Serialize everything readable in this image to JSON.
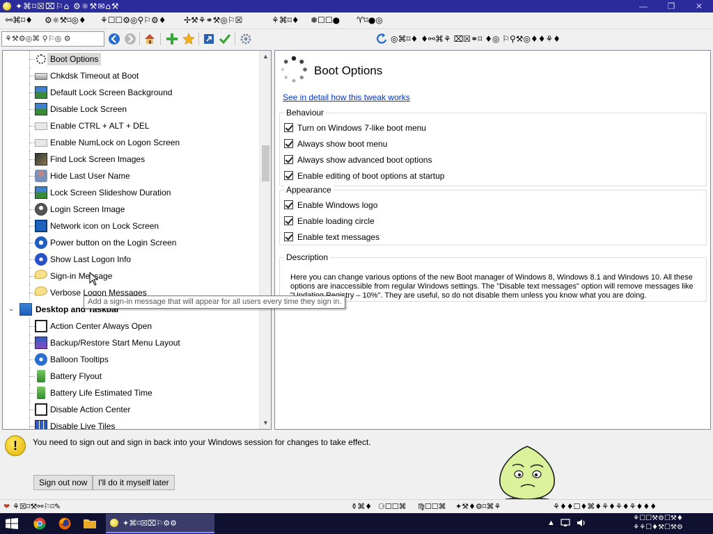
{
  "window": {
    "title": "✦⌘⌑☒⌧⚐⌂ ⚙⚛⚒✉⌂⚒",
    "minimize": "—",
    "maximize": "❐",
    "close": "✕"
  },
  "menu": [
    "⚯⌘⌑♦",
    "⚙⚛⚒⌑◎♦",
    "⚘☐☐⚙◎⚲⚐⚙♦",
    "✢⚒⚘⚭⚒◎⚐☒",
    "⚘⌘⌑♦",
    "❅☐☐●",
    "♈⌑●◎"
  ],
  "toolbar": {
    "search_placeholder": "⚘⚒⚙◎⌘ ⚲⚐◎ ⚙",
    "action_label": "◎⌘⌑♦ ♦⚯⌘⚘ ⌧☒⚭⌑ ♦◎ ⚐⚲⚒◎♦♦⚘♦"
  },
  "tree": {
    "items_top": [
      {
        "label": "Boot Options",
        "icon": "spinner-icon",
        "selected": true
      },
      {
        "label": "Chkdsk Timeout at Boot",
        "icon": "drive-icon"
      },
      {
        "label": "Default Lock Screen Background",
        "icon": "landscape-icon"
      },
      {
        "label": "Disable Lock Screen",
        "icon": "landscape-icon"
      },
      {
        "label": "Enable CTRL + ALT + DEL",
        "icon": "keyboard-icon"
      },
      {
        "label": "Enable NumLock on Logon Screen",
        "icon": "keyboard-icon"
      },
      {
        "label": "Find Lock Screen Images",
        "icon": "image-search-icon"
      },
      {
        "label": "Hide Last User Name",
        "icon": "user-icon"
      },
      {
        "label": "Lock Screen Slideshow Duration",
        "icon": "landscape-icon"
      },
      {
        "label": "Login Screen Image",
        "icon": "user-circle-icon"
      },
      {
        "label": "Network icon on Lock Screen",
        "icon": "monitor-icon"
      },
      {
        "label": "Power button on the Login Screen",
        "icon": "power-icon"
      },
      {
        "label": "Show Last Logon Info",
        "icon": "help-icon"
      },
      {
        "label": "Sign-in Message",
        "icon": "speech-bubble-icon"
      },
      {
        "label": "Verbose Logon Messages",
        "icon": "speech-bubble-icon"
      }
    ],
    "category": {
      "label": "Desktop and Taskbar",
      "expander": "⌄"
    },
    "items_bottom": [
      {
        "label": "Action Center Always Open",
        "icon": "action-center-icon"
      },
      {
        "label": "Backup/Restore Start Menu Layout",
        "icon": "start-menu-icon"
      },
      {
        "label": "Balloon Tooltips",
        "icon": "info-icon"
      },
      {
        "label": "Battery Flyout",
        "icon": "battery-icon"
      },
      {
        "label": "Battery Life Estimated Time",
        "icon": "battery-icon"
      },
      {
        "label": "Disable Action Center",
        "icon": "action-center-icon"
      },
      {
        "label": "Disable Live Tiles",
        "icon": "tiles-icon"
      }
    ],
    "tooltip": "Add a sign-in message that will appear for all users every time they sign in."
  },
  "detail": {
    "title": "Boot Options",
    "link": "See in detail how this tweak works",
    "behaviour": {
      "title": "Behaviour",
      "options": [
        {
          "label": "Turn on Windows 7-like boot menu",
          "checked": true
        },
        {
          "label": "Always show boot menu",
          "checked": true
        },
        {
          "label": "Always show advanced boot options",
          "checked": true
        },
        {
          "label": "Enable editing of boot options at startup",
          "checked": true
        }
      ]
    },
    "appearance": {
      "title": "Appearance",
      "options": [
        {
          "label": "Enable Windows logo",
          "checked": true
        },
        {
          "label": "Enable loading circle",
          "checked": true
        },
        {
          "label": "Enable text messages",
          "checked": true
        }
      ]
    },
    "description": {
      "title": "Description",
      "text": "Here you can change various options of the new Boot manager of Windows 8, Windows 8.1 and Windows 10. All these options are inaccessible from regular Windows settings. The \"Disable text messages\" option will remove messages like \"Updating Registry – 10%\". They are useful, so do not disable them unless you know what you are doing."
    }
  },
  "notice": {
    "text": "You need to sign out and sign in back into your Windows session for changes to take effect.",
    "sign_out_button": "Sign out now",
    "later_button": "I'll do it myself later"
  },
  "statusbar": {
    "left": "⚘☒⌑⚒⚯⚐⌑✎",
    "mid1": "⚱⌘♦",
    "mid2": "⚆☐☐⌘",
    "mid3": "♍☐☐⌘",
    "mid4": "✦⚒♦⚙⌑⌘⚘",
    "right": "⚘♦♦☐♦⌘♦⚘♦⚘♦⚘♦♦♦"
  },
  "taskbar": {
    "active_title": "✦⌘⌑☒⌧⚐⚙⚙",
    "clock_line1": "⚘☐☐⚒⚙☐⚒♦",
    "clock_line2": "⚘⚘☐♦⚒☐⚒⚙"
  }
}
